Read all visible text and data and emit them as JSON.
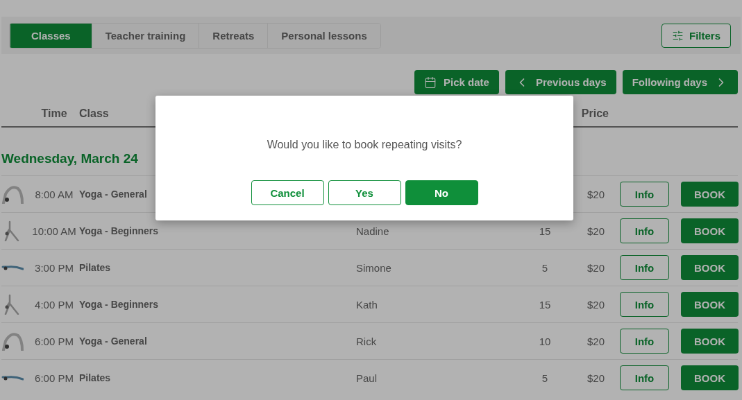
{
  "tabs": [
    {
      "label": "Classes",
      "selected": true
    },
    {
      "label": "Teacher training",
      "selected": false
    },
    {
      "label": "Retreats",
      "selected": false
    },
    {
      "label": "Personal lessons",
      "selected": false
    }
  ],
  "filters_button": "Filters",
  "date_nav": [
    {
      "kind": "pick",
      "label": "Pick date"
    },
    {
      "kind": "prev",
      "label": "Previous days"
    },
    {
      "kind": "next",
      "label": "Following days"
    }
  ],
  "table": {
    "header": {
      "time": "Time",
      "class": "Class",
      "price": "Price"
    },
    "day_heading": "Wednesday, March 24",
    "rows": [
      {
        "kind": "backbend",
        "time": "8:00 AM",
        "class": "Yoga - General",
        "price": "$20",
        "info": "Info",
        "book": "BOOK"
      },
      {
        "kind": "triangle",
        "time": "10:00 AM",
        "class": "Yoga - Beginners",
        "teacher": "Nadine",
        "spots": "15",
        "price": "$20",
        "info": "Info",
        "book": "BOOK"
      },
      {
        "kind": "plank",
        "time": "3:00 PM",
        "class": "Pilates",
        "teacher": "Simone",
        "spots": "5",
        "price": "$20",
        "info": "Info",
        "book": "BOOK"
      },
      {
        "kind": "triangle",
        "time": "4:00 PM",
        "class": "Yoga - Beginners",
        "teacher": "Kath",
        "spots": "15",
        "price": "$20",
        "info": "Info",
        "book": "BOOK"
      },
      {
        "kind": "backbend",
        "time": "6:00 PM",
        "class": "Yoga - General",
        "teacher": "Rick",
        "spots": "10",
        "price": "$20",
        "info": "Info",
        "book": "BOOK"
      },
      {
        "kind": "plank",
        "time": "6:00 PM",
        "class": "Pilates",
        "teacher": "Paul",
        "spots": "5",
        "price": "$20",
        "info": "Info",
        "book": "BOOK"
      }
    ]
  },
  "dialog": {
    "message": "Would you like to book repeating visits?",
    "buttons": [
      {
        "kind": "outline",
        "label": "Cancel"
      },
      {
        "kind": "outline",
        "label": "Yes"
      },
      {
        "kind": "filled",
        "label": "No"
      }
    ]
  }
}
